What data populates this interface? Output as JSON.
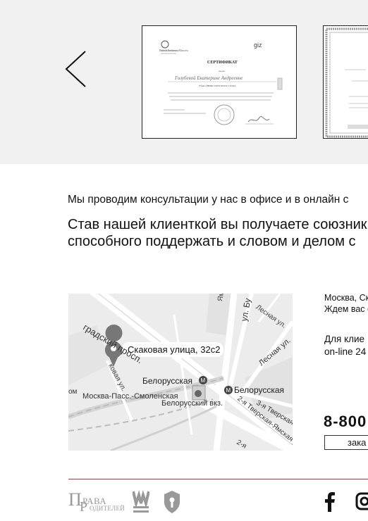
{
  "carousel": {
    "prev_label": "‹",
    "certificate": {
      "org_left": "British Embassy Moscow",
      "org_right": "giz",
      "title": "СЕРТИФИКАТ",
      "issued_to": "выдан",
      "name_handwritten": "Голубевой Екатерине Андреевне",
      "role": "УЧАСТНИКУ КРУГЛОГО СТОЛА",
      "body": "«Актуальные проблемы применения Гаагской Конвенции «О гражданско-правовых аспектах международного похищения детей» от 25.10.1980»"
    }
  },
  "intro": {
    "line1": "Мы проводим консультации у нас в офисе и в онлайн с",
    "line2a": "Став нашей клиенткой вы получаете союзника",
    "line2b": "способного поддержать и словом и делом с"
  },
  "map": {
    "pin_label": "Скаковая улица, 32с2",
    "labels": {
      "street_diag": "градский просп.",
      "yamskogo": "Ямского Поля",
      "ul_b": "ул. Бу",
      "lesnaya1": "Лесная ул.",
      "lesnaya2": "Лесная ул.",
      "skakovaya": "ковая ул.",
      "belorusskaya1": "Белорусская",
      "belorusskaya2": "Белорусская",
      "moskva_pass": "Москва-Пасс.-Смоленская",
      "bel_vokzal": "Белорусский вкз.",
      "tverskaya1": "3-я Тверская-",
      "tverskaya2": "2-я Тверская-Ямская ул.",
      "tverskaya3": "2-я",
      "om": "ом"
    }
  },
  "contacts": {
    "address": "Москва, Ск",
    "wait": "Ждем вас с",
    "clients_line1": "Для клие",
    "clients_line2": "on-line 24",
    "phone": "8-800",
    "order_button": "зака"
  },
  "footer": {
    "logo_text_top": "П",
    "logo_text_rava": "РАВА",
    "logo_text_r": "Р",
    "logo_text_oditeley": "ОДИТЕЛЕЙ"
  },
  "colors": {
    "accent_red": "#c9302c",
    "carousel_bg": "#f1f1f1",
    "map_bg": "#ececec"
  }
}
